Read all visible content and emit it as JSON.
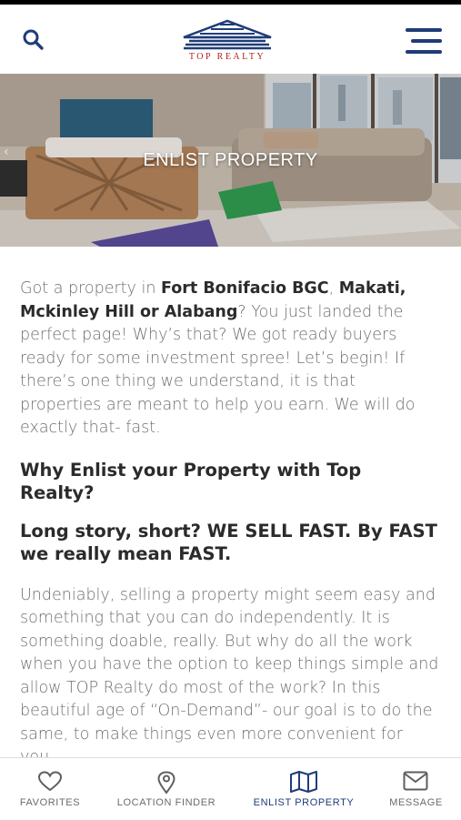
{
  "header": {
    "logo_text": "TOP REALTY",
    "brand_color": "#1f3c79",
    "logo_text_color": "#b22222",
    "icons": {
      "search": "search-icon",
      "menu": "hamburger-menu-icon"
    }
  },
  "hero": {
    "title": "ENLIST PROPERTY",
    "prev_arrow": "‹"
  },
  "content": {
    "intro": {
      "t1": "Got a property in ",
      "b1": "Fort Bonifacio BGC",
      "t2": ", ",
      "b2": "Makati, Mckinley Hill or  Alabang",
      "t3": "? You just landed the perfect page! Why’s that? We got ready buyers ready for some investment spree! Let’s begin! If there’s one thing we understand, it is that properties are meant to help you earn. We will do exactly that- fast."
    },
    "heading1": "Why Enlist your Property with Top Realty?",
    "heading2": "Long story, short? WE SELL FAST. By FAST we really mean FAST.",
    "paragraph2": "Undeniably, selling a property might seem easy and something that you can do independently. It is something doable, really. But why do all the work when you have the option to keep things simple and allow TOP Realty do most of the work?  In this beautiful age of “On-Demand”- our goal is to do the same, to make things even more convenient for you."
  },
  "bottom_nav": {
    "items": [
      {
        "label": "FAVORITES",
        "icon": "heart-icon"
      },
      {
        "label": "LOCATION FINDER",
        "icon": "map-pin-icon"
      },
      {
        "label": "ENLIST PROPERTY",
        "icon": "map-icon",
        "active": true
      },
      {
        "label": "MESSAGE",
        "icon": "mail-icon"
      }
    ],
    "active_color": "#1f3c79",
    "inactive_color": "#6b6b6b"
  }
}
